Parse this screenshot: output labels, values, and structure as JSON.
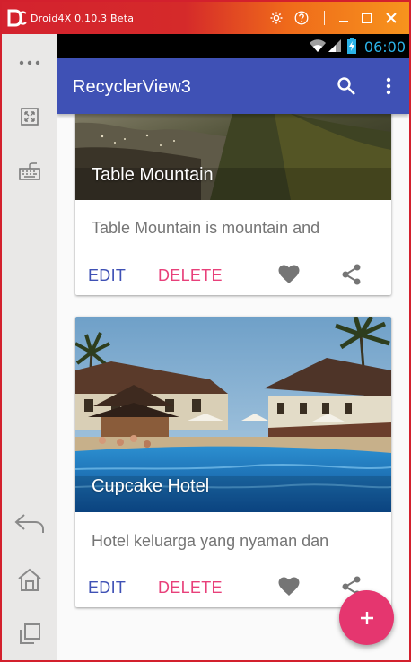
{
  "emulator": {
    "title": "Droid4X 0.10.3 Beta",
    "logo_icon": "droid4x-logo-icon",
    "buttons": [
      "settings-icon",
      "help-icon",
      "minimize-icon",
      "maximize-icon",
      "close-icon"
    ],
    "sidebar_buttons": [
      "more-icon",
      "fullscreen-icon",
      "keyboard-icon",
      "back-icon",
      "home-icon",
      "recents-icon"
    ]
  },
  "status_bar": {
    "time": "06:00",
    "icons": [
      "wifi-icon",
      "signal-icon",
      "battery-charging-icon"
    ]
  },
  "app_bar": {
    "title": "RecyclerView3",
    "color": "#3f51b5",
    "actions": [
      "search-icon",
      "overflow-menu-icon"
    ]
  },
  "cards": [
    {
      "title": "Table Mountain",
      "description": "Table Mountain is mountain and",
      "edit_label": "EDIT",
      "delete_label": "DELETE",
      "icons": [
        "favorite-icon",
        "share-icon"
      ]
    },
    {
      "title": "Cupcake Hotel",
      "description": "Hotel keluarga yang nyaman dan",
      "edit_label": "EDIT",
      "delete_label": "DELETE",
      "icons": [
        "favorite-icon",
        "share-icon"
      ]
    }
  ],
  "fab": {
    "label": "+",
    "icon": "add-icon",
    "color": "#e5366f"
  },
  "colors": {
    "primary": "#3f51b5",
    "accent": "#e8407a",
    "emulator_red": "#d4222e",
    "emulator_orange": "#f7941d"
  }
}
